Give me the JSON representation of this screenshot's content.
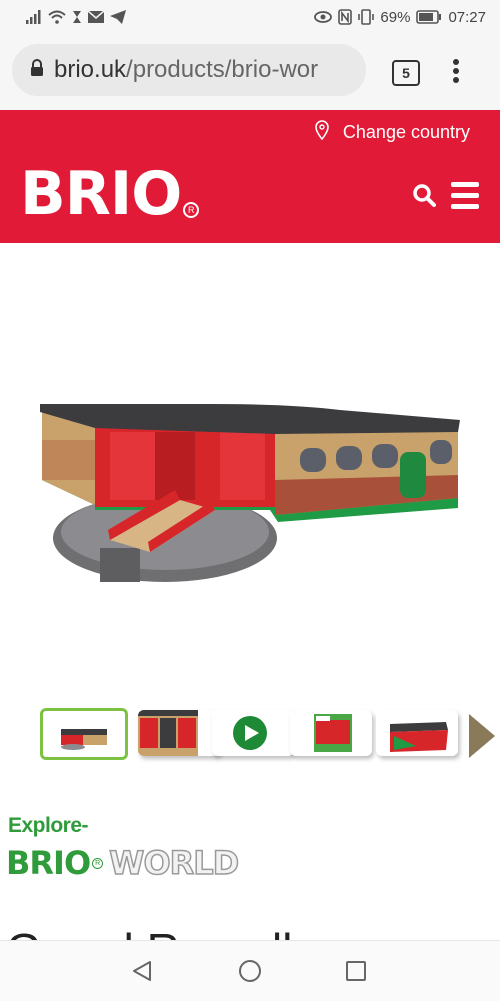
{
  "status_bar": {
    "battery": "69%",
    "time": "07:27"
  },
  "browser": {
    "url_domain": "brio.uk",
    "url_path": "/products/brio-wor",
    "tab_count": "5"
  },
  "header": {
    "change_country": "Change country",
    "logo_text": "BRIO",
    "logo_reg": "R",
    "brand_color": "#e11b37"
  },
  "thumbnails": [
    {
      "name": "roundhouse-front",
      "selected": true
    },
    {
      "name": "roundhouse-interior",
      "selected": false
    },
    {
      "name": "video",
      "selected": false
    },
    {
      "name": "box",
      "selected": false
    },
    {
      "name": "roundhouse-top",
      "selected": false
    }
  ],
  "explore": {
    "label": "Explore-",
    "brand": "BRIO",
    "reg": "R",
    "world": "WORLD",
    "accent_color": "#2f9b3a"
  },
  "product": {
    "title": "Grand Roundhouse"
  }
}
